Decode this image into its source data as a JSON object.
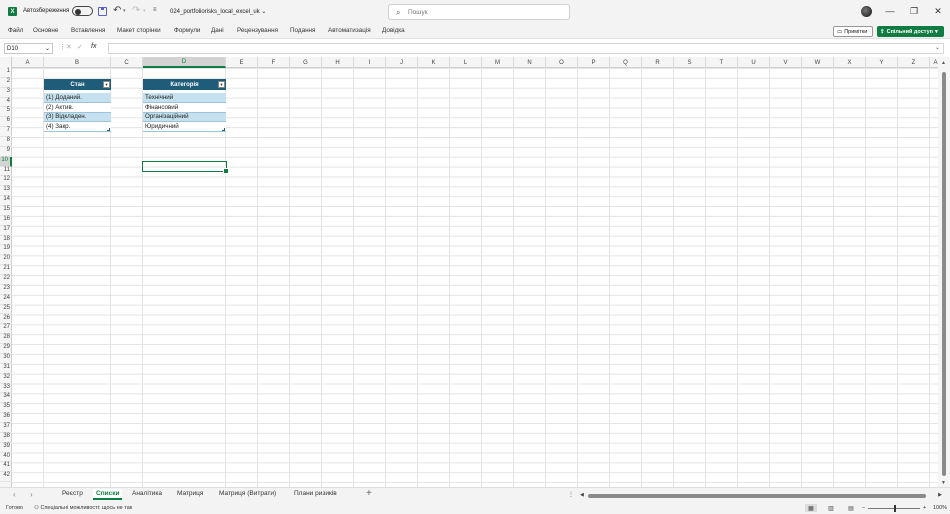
{
  "titlebar": {
    "app_icon": "X",
    "autosave_label": "Автозбереження",
    "filename": "024_portfoliorisks_local_excel_uk",
    "search_placeholder": "Пошук",
    "min_symbol": "—",
    "restore_symbol": "❐",
    "close_symbol": "✕"
  },
  "ribbon": {
    "tabs": [
      "Файл",
      "Основне",
      "Вставлення",
      "Макет сторінки",
      "Формули",
      "Дані",
      "Рецензування",
      "Подання",
      "Автоматизація",
      "Довідка"
    ],
    "notes_label": "Примітки",
    "share_label": "Спільний доступ"
  },
  "formula_bar": {
    "name_box": "D10",
    "fx": "fx",
    "value": ""
  },
  "grid": {
    "columns": [
      "A",
      "B",
      "C",
      "D",
      "E",
      "F",
      "G",
      "H",
      "I",
      "J",
      "K",
      "L",
      "M",
      "N",
      "O",
      "P",
      "Q",
      "R",
      "S",
      "T",
      "U",
      "V",
      "W",
      "X",
      "Y",
      "Z",
      "A"
    ],
    "selected_column": "D",
    "row_count": 42,
    "selected_row": 10,
    "selected_cell": "D10"
  },
  "table_status": {
    "header": "Стан",
    "rows": [
      "(1) Доданий.",
      "(2) Актив.",
      "(3) Відкладен.",
      "(4) Закр."
    ]
  },
  "table_category": {
    "header": "Категорія",
    "rows": [
      "Технічний",
      "Фінансовий",
      "Організаційний",
      "Юридичний"
    ]
  },
  "sheets": {
    "tabs": [
      "Реєстр",
      "Списки",
      "Аналітика",
      "Матриця",
      "Матриця (Витрати)",
      "Плани ризиків"
    ],
    "active": "Списки",
    "add_symbol": "+"
  },
  "status": {
    "ready": "Готово",
    "accessibility": "Спеціальні можливості: щось не так",
    "zoom": "100%"
  },
  "colors": {
    "accent": "#107c41",
    "table_header": "#1f5c7a",
    "table_band": "#c5e0ee"
  }
}
